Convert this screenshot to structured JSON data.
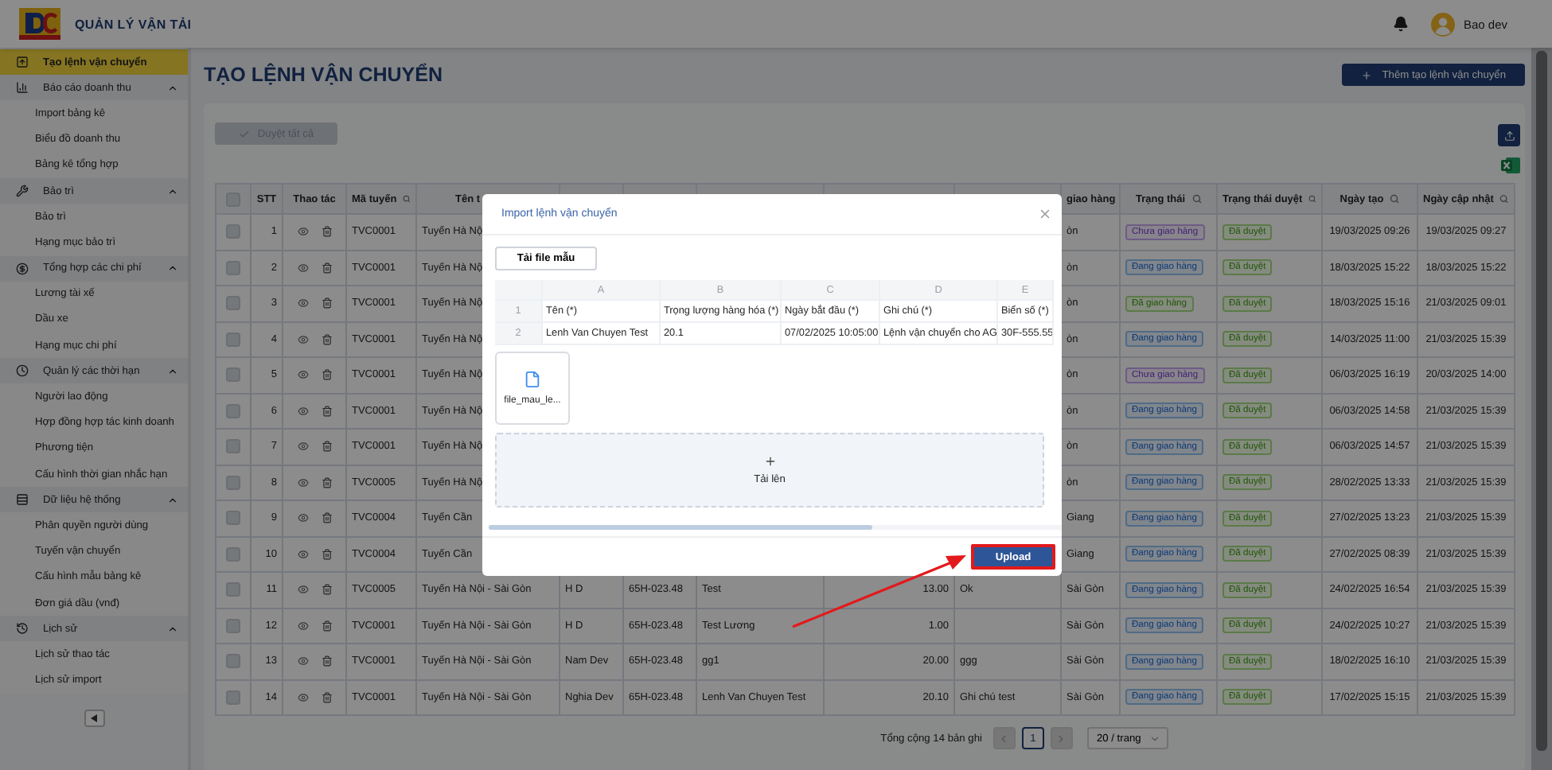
{
  "header": {
    "app_title": "QUẢN LÝ VẬN TẢI",
    "user_name": "Bao dev"
  },
  "sidebar": {
    "items": [
      {
        "label": "Tạo lệnh vận chuyển",
        "selected": true
      },
      {
        "label": "Báo cáo doanh thu",
        "expanded": true,
        "children": [
          {
            "label": "Import bảng kê",
            "selected": false
          },
          {
            "label": "Biểu đồ doanh thu",
            "selected": false
          },
          {
            "label": "Bảng kê tổng hợp",
            "selected": false
          }
        ]
      },
      {
        "label": "Bảo trì",
        "expanded": true,
        "children": [
          {
            "label": "Bảo trì",
            "selected": false
          },
          {
            "label": "Hạng mục bảo trì",
            "selected": false
          }
        ]
      },
      {
        "label": "Tổng hợp các chi phí",
        "expanded": true,
        "children": [
          {
            "label": "Lương tài xế",
            "selected": false
          },
          {
            "label": "Dầu xe",
            "selected": false
          },
          {
            "label": "Hạng mục chi phí",
            "selected": false
          }
        ]
      },
      {
        "label": "Quản lý các thời hạn",
        "expanded": true,
        "children": [
          {
            "label": "Người lao động",
            "selected": false
          },
          {
            "label": "Hợp đồng hợp tác kinh doanh",
            "selected": false
          },
          {
            "label": "Phương tiện",
            "selected": false
          },
          {
            "label": "Cấu hình thời gian nhắc hạn",
            "selected": false
          }
        ]
      },
      {
        "label": "Dữ liệu hệ thống",
        "expanded": true,
        "children": [
          {
            "label": "Phân quyền người dùng",
            "selected": false
          },
          {
            "label": "Tuyến vận chuyển",
            "selected": false
          },
          {
            "label": "Cấu hình mẫu bảng kê",
            "selected": false
          },
          {
            "label": "Đơn giá dầu (vnđ)",
            "selected": false
          }
        ]
      },
      {
        "label": "Lịch sử",
        "expanded": true,
        "children": [
          {
            "label": "Lịch sử thao tác",
            "selected": false
          },
          {
            "label": "Lịch sử import",
            "selected": false
          }
        ]
      }
    ]
  },
  "page": {
    "title": "TẠO LỆNH VẬN CHUYỂN",
    "add_button": "Thêm tạo lệnh vận chuyển",
    "approve_all_button": {
      "label": "Duyệt tất cả",
      "disabled": true
    }
  },
  "table": {
    "select_all_checked": false,
    "columns": [
      {
        "label": "STT",
        "kind": "number"
      },
      {
        "label": "Thao tác",
        "kind": "actions"
      },
      {
        "label": "Mã tuyến",
        "kind": "text",
        "searchable": true
      },
      {
        "label": "Tên t",
        "kind": "text"
      },
      {
        "kind": "text"
      },
      {
        "kind": "text"
      },
      {
        "kind": "text"
      },
      {
        "kind": "number"
      },
      {
        "kind": "text"
      },
      {
        "label": "giao hàng",
        "kind": "text"
      },
      {
        "label": "Trạng thái",
        "kind": "tag",
        "searchable": true
      },
      {
        "label": "Trạng thái duyệt",
        "kind": "tag",
        "searchable": true
      },
      {
        "label": "Ngày tạo",
        "kind": "date",
        "searchable": true
      },
      {
        "label": "Ngày cập nhật",
        "kind": "date",
        "searchable": true
      }
    ],
    "rows": [
      {
        "checked": false,
        "cells": [
          "1",
          "",
          "TVC0001",
          "Tuyến Hà Nộ",
          "",
          "",
          "",
          "",
          "",
          "òn",
          {
            "label": "Chưa giao hàng",
            "kind": "pending"
          },
          {
            "label": "Đã duyệt",
            "kind": "approved"
          },
          "19/03/2025 09:26",
          "19/03/2025 09:27"
        ]
      },
      {
        "checked": false,
        "cells": [
          "2",
          "",
          "TVC0001",
          "Tuyến Hà Nộ",
          "",
          "",
          "",
          "",
          "",
          "òn",
          {
            "label": "Đang giao hàng",
            "kind": "shipping"
          },
          {
            "label": "Đã duyệt",
            "kind": "approved"
          },
          "18/03/2025 15:22",
          "18/03/2025 15:22"
        ]
      },
      {
        "checked": false,
        "cells": [
          "3",
          "",
          "TVC0001",
          "Tuyến Hà Nộ",
          "",
          "",
          "",
          "",
          "",
          "òn",
          {
            "label": "Đã giao hàng",
            "kind": "delivered"
          },
          {
            "label": "Đã duyệt",
            "kind": "approved"
          },
          "18/03/2025 15:16",
          "21/03/2025 09:01"
        ]
      },
      {
        "checked": false,
        "cells": [
          "4",
          "",
          "TVC0001",
          "Tuyến Hà Nộ",
          "",
          "",
          "",
          "",
          "",
          "òn",
          {
            "label": "Đang giao hàng",
            "kind": "shipping"
          },
          {
            "label": "Đã duyệt",
            "kind": "approved"
          },
          "14/03/2025 11:00",
          "21/03/2025 15:39"
        ]
      },
      {
        "checked": false,
        "cells": [
          "5",
          "",
          "TVC0001",
          "Tuyến Hà Nộ",
          "",
          "",
          "",
          "",
          "",
          "òn",
          {
            "label": "Chưa giao hàng",
            "kind": "pending"
          },
          {
            "label": "Đã duyệt",
            "kind": "approved"
          },
          "06/03/2025 16:19",
          "20/03/2025 14:00"
        ]
      },
      {
        "checked": false,
        "cells": [
          "6",
          "",
          "TVC0001",
          "Tuyến Hà Nộ",
          "",
          "",
          "",
          "",
          "",
          "òn",
          {
            "label": "Đang giao hàng",
            "kind": "shipping"
          },
          {
            "label": "Đã duyệt",
            "kind": "approved"
          },
          "06/03/2025 14:58",
          "21/03/2025 15:39"
        ]
      },
      {
        "checked": false,
        "cells": [
          "7",
          "",
          "TVC0001",
          "Tuyến Hà Nộ",
          "",
          "",
          "",
          "",
          "",
          "òn",
          {
            "label": "Đang giao hàng",
            "kind": "shipping"
          },
          {
            "label": "Đã duyệt",
            "kind": "approved"
          },
          "06/03/2025 14:57",
          "21/03/2025 15:39"
        ]
      },
      {
        "checked": false,
        "cells": [
          "8",
          "",
          "TVC0005",
          "Tuyến Hà Nộ",
          "",
          "",
          "",
          "",
          "",
          "òn",
          {
            "label": "Đang giao hàng",
            "kind": "shipping"
          },
          {
            "label": "Đã duyệt",
            "kind": "approved"
          },
          "28/02/2025 13:33",
          "21/03/2025 15:39"
        ]
      },
      {
        "checked": false,
        "cells": [
          "9",
          "",
          "TVC0004",
          "Tuyến Cần",
          "",
          "",
          "",
          "",
          "",
          "Giang",
          {
            "label": "Đang giao hàng",
            "kind": "shipping"
          },
          {
            "label": "Đã duyệt",
            "kind": "approved"
          },
          "27/02/2025 13:23",
          "21/03/2025 15:39"
        ]
      },
      {
        "checked": false,
        "cells": [
          "10",
          "",
          "TVC0004",
          "Tuyến Cần",
          "",
          "",
          "",
          "",
          "",
          "Giang",
          {
            "label": "Đang giao hàng",
            "kind": "shipping"
          },
          {
            "label": "Đã duyệt",
            "kind": "approved"
          },
          "27/02/2025 08:39",
          "21/03/2025 15:39"
        ]
      },
      {
        "checked": false,
        "cells": [
          "11",
          "",
          "TVC0005",
          "Tuyến Hà Nội - Sài Gòn",
          "H D",
          "65H-023.48",
          "Test",
          "13.00",
          "Ok",
          "Sài Gòn",
          {
            "label": "Đang giao hàng",
            "kind": "shipping"
          },
          {
            "label": "Đã duyệt",
            "kind": "approved"
          },
          "24/02/2025 16:54",
          "21/03/2025 15:39"
        ]
      },
      {
        "checked": false,
        "cells": [
          "12",
          "",
          "TVC0001",
          "Tuyến Hà Nội - Sài Gòn",
          "H D",
          "65H-023.48",
          "Test Lương",
          "1.00",
          "",
          "Sài Gòn",
          {
            "label": "Đang giao hàng",
            "kind": "shipping"
          },
          {
            "label": "Đã duyệt",
            "kind": "approved"
          },
          "24/02/2025 10:27",
          "21/03/2025 15:39"
        ]
      },
      {
        "checked": false,
        "cells": [
          "13",
          "",
          "TVC0001",
          "Tuyến Hà Nội - Sài Gòn",
          "Nam Dev",
          "65H-023.48",
          "gg1",
          "20.00",
          "ggg",
          "Sài Gòn",
          {
            "label": "Đang giao hàng",
            "kind": "shipping"
          },
          {
            "label": "Đã duyệt",
            "kind": "approved"
          },
          "18/02/2025 16:10",
          "21/03/2025 15:39"
        ]
      },
      {
        "checked": false,
        "cells": [
          "14",
          "",
          "TVC0001",
          "Tuyến Hà Nội - Sài Gòn",
          "Nghia Dev",
          "65H-023.48",
          "Lenh Van Chuyen Test",
          "20.10",
          "Ghi chú test",
          "Sài Gòn",
          {
            "label": "Đang giao hàng",
            "kind": "shipping"
          },
          {
            "label": "Đã duyệt",
            "kind": "approved"
          },
          "17/02/2025 15:15",
          "21/03/2025 15:39"
        ]
      }
    ]
  },
  "pagination": {
    "total": "Tổng cộng 14 bản ghi",
    "prev_disabled": true,
    "pages": [
      {
        "label": "1",
        "selected": true
      }
    ],
    "next_disabled": true,
    "page_size": "20 / trang"
  },
  "dialog": {
    "title": "Import lệnh vận chuyển",
    "template_button": "Tải file mẫu",
    "preview": {
      "columns": [
        "",
        "A",
        "B",
        "C",
        "D",
        "E"
      ],
      "rows": [
        [
          "1",
          "Tên (*)",
          "Trọng lượng hàng hóa (*)",
          "Ngày bắt đầu (*)",
          "Ghi chú (*)",
          "Biển số (*)"
        ],
        [
          "2",
          "Lenh Van Chuyen Test",
          "20.1",
          "07/02/2025 10:05:00",
          "Lệnh vận chuyển cho AG",
          "30F-555.55"
        ]
      ]
    },
    "files": [
      {
        "name": "file_mau_le..."
      }
    ],
    "dropzone": {
      "label": "Tải lên"
    },
    "upload_button": {
      "label": "Upload",
      "highlighted": true
    }
  }
}
